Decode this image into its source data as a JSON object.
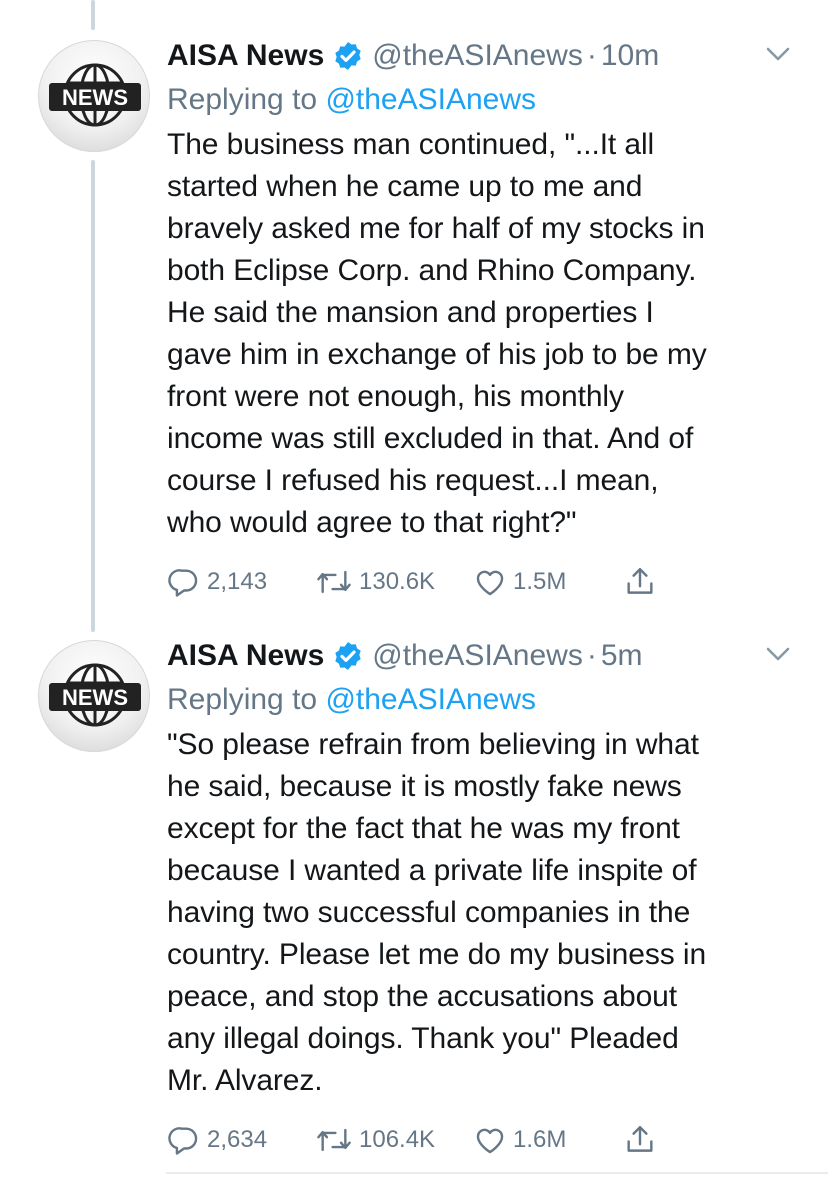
{
  "colors": {
    "name": "#14171a",
    "secondary": "#657786",
    "link": "#1da1f2",
    "verified": "#1da1f2",
    "thread_line": "#ccd6dd"
  },
  "tweets": [
    {
      "avatar_label": "NEWS",
      "name": "AISA News",
      "handle": "@theASIAnews",
      "separator": "·",
      "time": "10m",
      "replying_prefix": "Replying to",
      "replying_to": "@theASIAnews",
      "text_lines": [
        "The business man continued, \"...It all",
        "started when he came up to me and",
        "bravely asked me for half of my stocks in",
        "both Eclipse Corp. and Rhino Company.",
        "He said the mansion and properties I",
        "gave him in exchange of his job to be my",
        "front were not enough, his monthly",
        "income was still excluded in that. And of",
        "course I refused his request...I mean,",
        "who would agree to that right?\""
      ],
      "replies": "2,143",
      "retweets": "130.6K",
      "likes": "1.5M",
      "icons": [
        "reply-icon",
        "retweet-icon",
        "like-icon",
        "share-icon"
      ]
    },
    {
      "avatar_label": "NEWS",
      "name": "AISA News",
      "handle": "@theASIAnews",
      "separator": "·",
      "time": "5m",
      "replying_prefix": "Replying to",
      "replying_to": "@theASIAnews",
      "text_lines": [
        "\"So please refrain from believing in what",
        "he said, because it is mostly fake news",
        "except for the fact that he was my front",
        "because I wanted a private life inspite of",
        "having two successful companies in the",
        "country. Please let me do my business in",
        "peace, and stop the accusations about",
        "any illegal doings. Thank you\" Pleaded",
        "Mr. Alvarez."
      ],
      "replies": "2,634",
      "retweets": "106.4K",
      "likes": "1.6M",
      "icons": [
        "reply-icon",
        "retweet-icon",
        "like-icon",
        "share-icon"
      ]
    }
  ]
}
